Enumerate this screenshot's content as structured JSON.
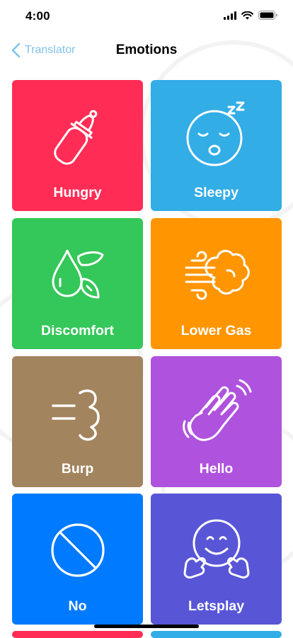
{
  "status": {
    "time": "4:00"
  },
  "nav": {
    "back_label": "Translator",
    "title": "Emotions"
  },
  "colors": {
    "red": "#ff2d55",
    "blue": "#32ade6",
    "green": "#34c759",
    "orange": "#ff9500",
    "brown": "#a2845e",
    "purple": "#af52de",
    "bright_blue": "#007aff",
    "indigo": "#5856d6",
    "back": "#82c3ec"
  },
  "tiles": [
    {
      "label": "Hungry",
      "icon": "baby-bottle-icon",
      "color": "#ff2d55"
    },
    {
      "label": "Sleepy",
      "icon": "sleepy-face-icon",
      "color": "#32ade6"
    },
    {
      "label": "Discomfort",
      "icon": "droplets-icon",
      "color": "#34c759"
    },
    {
      "label": "Lower Gas",
      "icon": "wind-cloud-icon",
      "color": "#ff9500"
    },
    {
      "label": "Burp",
      "icon": "burp-puff-icon",
      "color": "#a2845e"
    },
    {
      "label": "Hello",
      "icon": "waving-hand-icon",
      "color": "#af52de"
    },
    {
      "label": "No",
      "icon": "prohibited-icon",
      "color": "#007aff"
    },
    {
      "label": "Letsplay",
      "icon": "hugging-face-icon",
      "color": "#5856d6"
    }
  ]
}
